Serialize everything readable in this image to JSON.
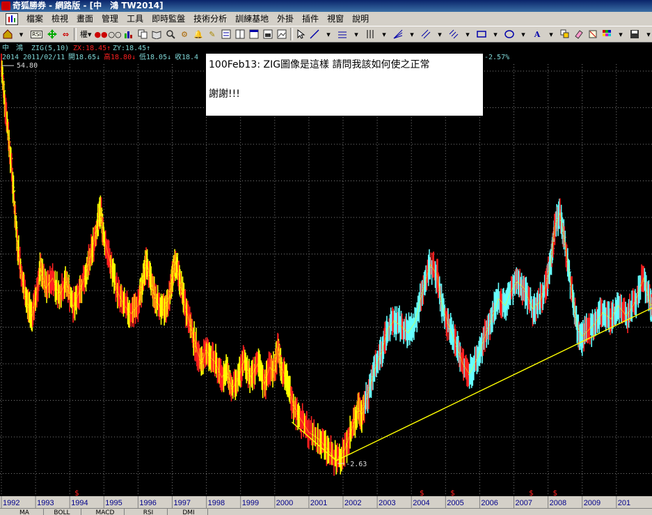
{
  "window": {
    "title": "奇狐勝券 - 網路版 - [中　鴻 TW2014]"
  },
  "menu": {
    "items": [
      "檔案",
      "檢視",
      "畫面",
      "管理",
      "工具",
      "即時監盤",
      "技術分析",
      "訓練基地",
      "外掛",
      "插件",
      "視窗",
      "說明"
    ]
  },
  "toolbar": {
    "rsi_label": "RSI",
    "right_label": "權"
  },
  "chart_header": {
    "line1": {
      "stock": "中　鴻",
      "indicator": "ZIG(5,10)",
      "zx": "ZX:18.45↑",
      "zy": "ZY:18.45↑"
    },
    "line2": {
      "code_date": "2014 2011/02/11",
      "open": "開18.65↓",
      "high": "高18.80↓",
      "low": "低18.05↓",
      "close": "收18.4",
      "change": "-2.57%"
    }
  },
  "note": {
    "line1": "100Feb13:  ZIG圖像是這樣 請問我該如何使之正常",
    "line2": "謝謝!!!"
  },
  "colors": {
    "bg": "#000000",
    "grid": "#7a7a7a",
    "yellow": "#ffff00",
    "red": "#ff2020",
    "cyan": "#66ffff",
    "header": "#7fd7d7"
  },
  "chart_data": {
    "type": "line",
    "title": "",
    "xlabel": "",
    "ylabel": "",
    "x_ticks": [
      "1992",
      "1993",
      "1994",
      "1995",
      "1996",
      "1997",
      "1998",
      "1999",
      "2000",
      "2001",
      "2002",
      "2003",
      "2004",
      "2005",
      "2006",
      "2007",
      "2008",
      "2009",
      "201"
    ],
    "x_range": [
      1992.0,
      2011.1
    ],
    "price_markers": {
      "high": "54.80",
      "low": "-2.63"
    },
    "series": [
      {
        "values": [
          [
            1992.0,
            54.8
          ],
          [
            1992.15,
            47.5
          ],
          [
            1992.3,
            40.0
          ],
          [
            1992.45,
            30.0
          ],
          [
            1992.6,
            24.0
          ],
          [
            1992.75,
            20.5
          ],
          [
            1992.9,
            18.5
          ],
          [
            1993.0,
            21.0
          ],
          [
            1993.15,
            25.5
          ],
          [
            1993.3,
            22.5
          ],
          [
            1993.5,
            24.0
          ],
          [
            1993.7,
            21.5
          ],
          [
            1993.9,
            23.5
          ],
          [
            1994.1,
            19.8
          ],
          [
            1994.3,
            22.2
          ],
          [
            1994.5,
            25.0
          ],
          [
            1994.65,
            28.0
          ],
          [
            1994.8,
            31.5
          ],
          [
            1994.9,
            33.8
          ],
          [
            1995.0,
            30.0
          ],
          [
            1995.2,
            26.0
          ],
          [
            1995.4,
            22.0
          ],
          [
            1995.6,
            20.0
          ],
          [
            1995.8,
            18.8
          ],
          [
            1996.0,
            20.0
          ],
          [
            1996.15,
            23.5
          ],
          [
            1996.25,
            26.5
          ],
          [
            1996.4,
            23.0
          ],
          [
            1996.55,
            20.5
          ],
          [
            1996.75,
            19.2
          ],
          [
            1996.9,
            21.0
          ],
          [
            1997.0,
            24.0
          ],
          [
            1997.1,
            26.5
          ],
          [
            1997.25,
            23.0
          ],
          [
            1997.4,
            19.5
          ],
          [
            1997.55,
            16.8
          ],
          [
            1997.7,
            14.0
          ],
          [
            1997.85,
            11.5
          ],
          [
            1998.0,
            13.5
          ],
          [
            1998.1,
            12.5
          ],
          [
            1998.25,
            11.8
          ],
          [
            1998.45,
            9.5
          ],
          [
            1998.6,
            10.5
          ],
          [
            1998.75,
            7.8
          ],
          [
            1998.95,
            9.5
          ],
          [
            1999.1,
            12.0
          ],
          [
            1999.3,
            9.5
          ],
          [
            1999.5,
            11.5
          ],
          [
            1999.7,
            8.5
          ],
          [
            1999.85,
            11.0
          ],
          [
            2000.0,
            10.5
          ],
          [
            2000.1,
            14.0
          ],
          [
            2000.2,
            11.0
          ],
          [
            2000.35,
            9.0
          ],
          [
            2000.55,
            5.5
          ],
          [
            2000.75,
            3.5
          ],
          [
            2001.0,
            1.5
          ],
          [
            2001.3,
            0.5
          ],
          [
            2001.55,
            -1.0
          ],
          [
            2001.8,
            -2.63
          ],
          [
            2002.05,
            -1.0
          ],
          [
            2002.3,
            2.5
          ],
          [
            2002.45,
            5.0
          ],
          [
            2002.55,
            4.0
          ],
          [
            2002.75,
            7.5
          ],
          [
            2002.95,
            11.0
          ],
          [
            2003.15,
            13.5
          ],
          [
            2003.3,
            16.5
          ],
          [
            2003.5,
            17.8
          ],
          [
            2003.7,
            17.0
          ],
          [
            2003.9,
            16.0
          ],
          [
            2004.1,
            17.5
          ],
          [
            2004.35,
            22.5
          ],
          [
            2004.55,
            26.0
          ],
          [
            2004.75,
            24.5
          ],
          [
            2004.9,
            20.0
          ],
          [
            2005.1,
            17.0
          ],
          [
            2005.3,
            14.5
          ],
          [
            2005.5,
            11.5
          ],
          [
            2005.7,
            10.0
          ],
          [
            2005.95,
            12.5
          ],
          [
            2006.15,
            15.5
          ],
          [
            2006.35,
            18.0
          ],
          [
            2006.55,
            21.0
          ],
          [
            2006.75,
            20.0
          ],
          [
            2006.9,
            22.0
          ],
          [
            2007.1,
            23.5
          ],
          [
            2007.3,
            22.5
          ],
          [
            2007.55,
            19.5
          ],
          [
            2007.75,
            20.5
          ],
          [
            2007.95,
            23.0
          ],
          [
            2008.1,
            27.0
          ],
          [
            2008.2,
            31.5
          ],
          [
            2008.35,
            33.5
          ],
          [
            2008.5,
            29.0
          ],
          [
            2008.7,
            22.0
          ],
          [
            2008.85,
            17.0
          ],
          [
            2009.0,
            15.5
          ],
          [
            2009.2,
            16.5
          ],
          [
            2009.4,
            17.5
          ],
          [
            2009.6,
            19.0
          ],
          [
            2009.85,
            18.0
          ],
          [
            2010.05,
            20.0
          ],
          [
            2010.3,
            18.5
          ],
          [
            2010.55,
            20.5
          ],
          [
            2010.8,
            24.0
          ],
          [
            2011.0,
            20.0
          ],
          [
            2011.1,
            20.5
          ]
        ]
      }
    ],
    "zig_line": [
      [
        2000.5,
        3.0
      ],
      [
        2001.8,
        -2.63
      ],
      [
        2011.1,
        19.8
      ]
    ],
    "signal_x": [
      1994.2,
      2004.3,
      2005.2,
      2007.5,
      2008.2
    ],
    "ylim": [
      -5,
      58
    ],
    "grid": true
  },
  "tabs": [
    "MA",
    "BOLL",
    "MACD",
    "RSI",
    "DMI"
  ]
}
